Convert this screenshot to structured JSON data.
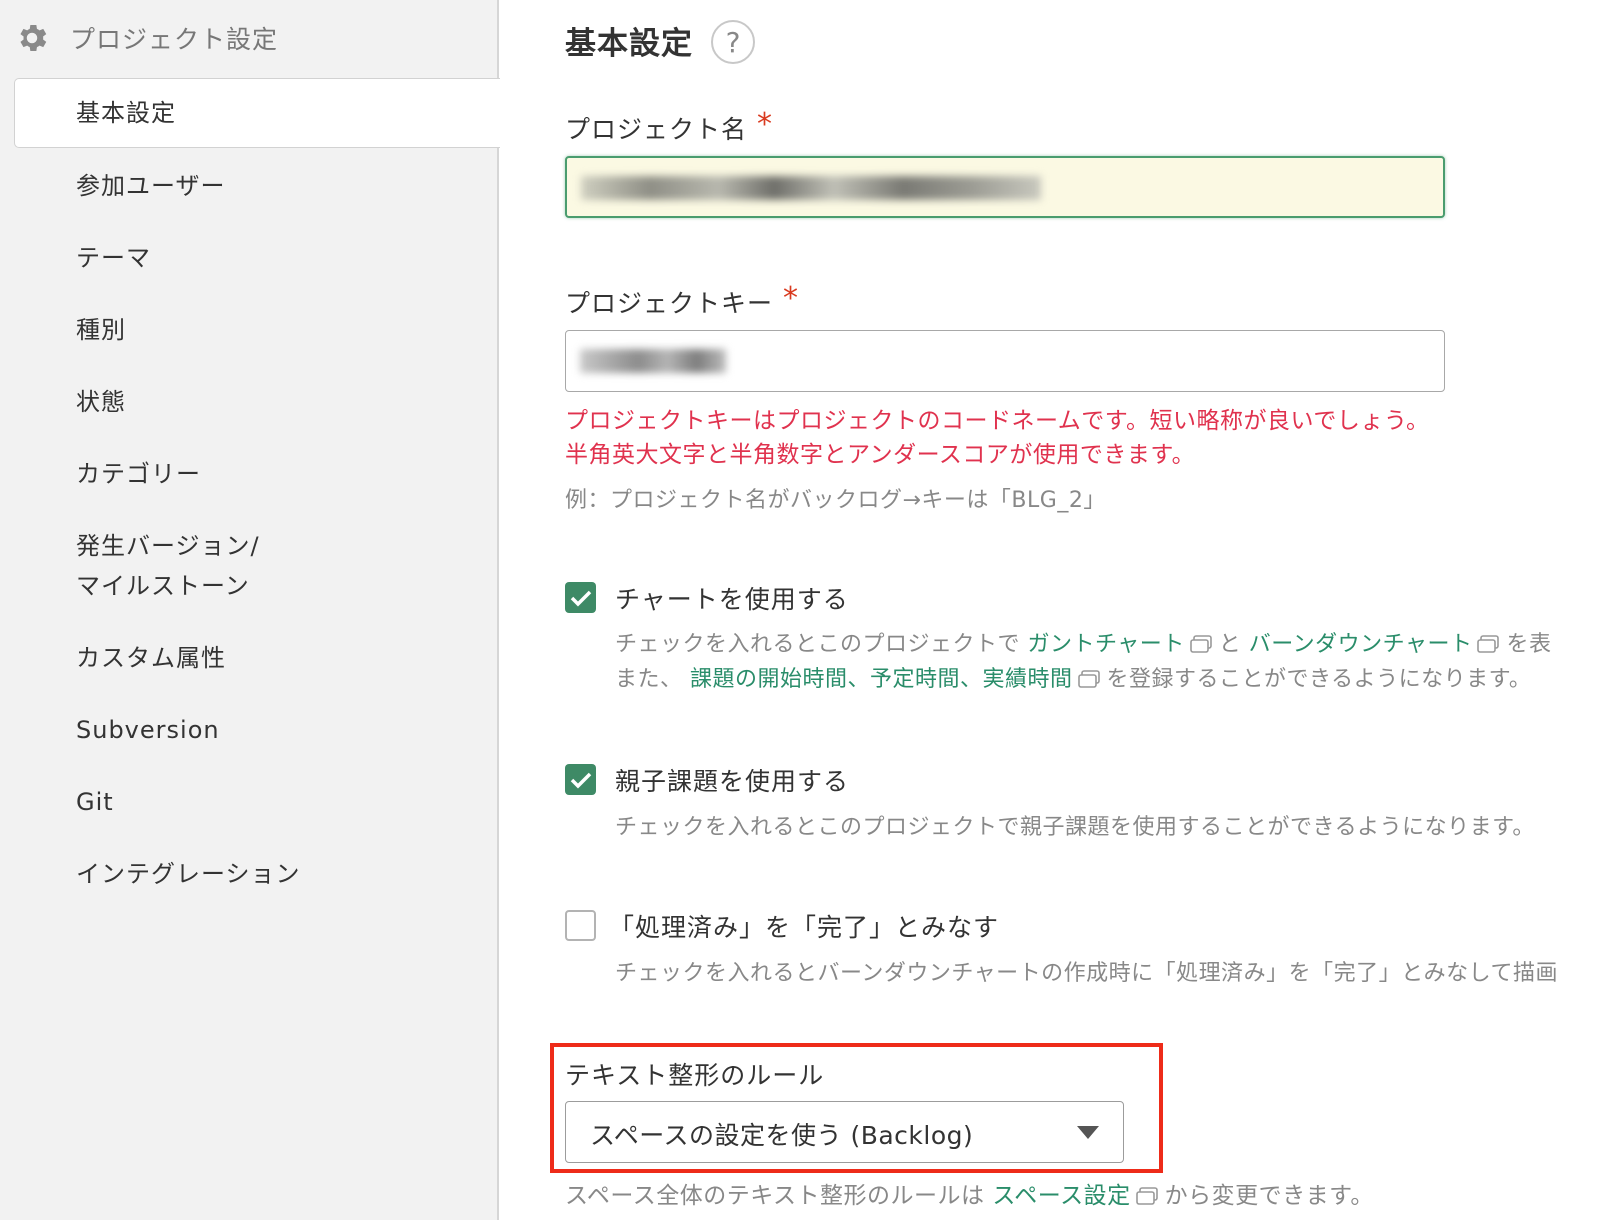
{
  "sidebar": {
    "header": {
      "icon": "gear-icon",
      "label": "プロジェクト設定"
    },
    "items": [
      {
        "label": "基本設定",
        "active": true
      },
      {
        "label": "参加ユーザー"
      },
      {
        "label": "テーマ"
      },
      {
        "label": "種別"
      },
      {
        "label": "状態"
      },
      {
        "label": "カテゴリー"
      },
      {
        "label": "発生バージョン/",
        "label2": "マイルストーン"
      },
      {
        "label": "カスタム属性"
      },
      {
        "label": "Subversion"
      },
      {
        "label": "Git"
      },
      {
        "label": "インテグレーション"
      }
    ]
  },
  "main": {
    "title": "基本設定",
    "help_symbol": "?",
    "project_name": {
      "label": "プロジェクト名",
      "required_mark": "*"
    },
    "project_key": {
      "label": "プロジェクトキー",
      "required_mark": "*",
      "error_line1": "プロジェクトキーはプロジェクトのコードネームです。短い略称が良いでしょう。",
      "error_line2": "半角英大文字と半角数字とアンダースコアが使用できます。",
      "example": "例：プロジェクト名がバックログ→キーは「BLG_2」"
    },
    "chart_option": {
      "label": "チャートを使用する",
      "checked": true,
      "desc1_pre": "チェックを入れるとこのプロジェクトで ",
      "link_gantt": "ガントチャート",
      "desc1_mid": "と ",
      "link_burndown": "バーンダウンチャート",
      "desc1_post": "を表",
      "desc2_pre": "また、 ",
      "link_times": "課題の開始時間、予定時間、実績時間",
      "desc2_post": "を登録することができるようになります。"
    },
    "parent_child_option": {
      "label": "親子課題を使用する",
      "checked": true,
      "desc": "チェックを入れるとこのプロジェクトで親子課題を使用することができるようになります。"
    },
    "resolved_option": {
      "label": "「処理済み」を「完了」とみなす",
      "checked": false,
      "desc": "チェックを入れるとバーンダウンチャートの作成時に「処理済み」を「完了」とみなして描画"
    },
    "text_format": {
      "label": "テキスト整形のルール",
      "selected": "スペースの設定を使う (Backlog)",
      "note_pre": "スペース全体のテキスト整形のルールは ",
      "note_link": "スペース設定",
      "note_post": "から変更できます。"
    }
  },
  "colors": {
    "accent": "#3e8a66",
    "link": "#2a8d6a",
    "error": "#e0324e",
    "highlight": "#ee2b19"
  }
}
